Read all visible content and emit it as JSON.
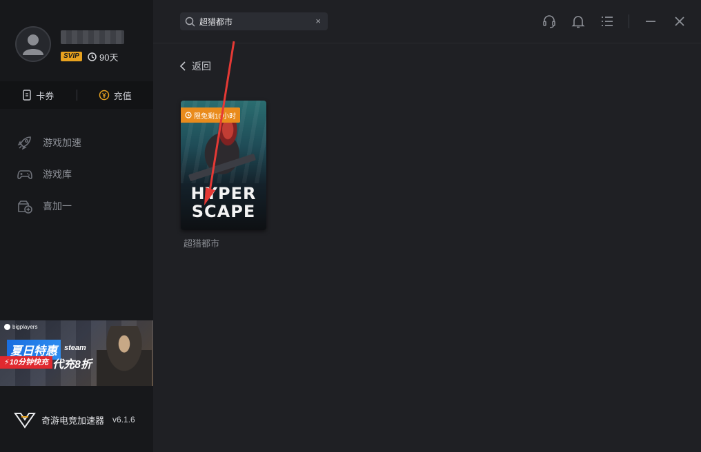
{
  "user": {
    "vip_badge": "SVIP",
    "days_left": "90天"
  },
  "wallet": {
    "coupons_label": "卡券",
    "recharge_label": "充值"
  },
  "nav": {
    "items": [
      {
        "label": "游戏加速",
        "icon": "rocket-icon"
      },
      {
        "label": "游戏库",
        "icon": "gamepad-icon"
      },
      {
        "label": "喜加一",
        "icon": "gift-plus-icon"
      }
    ]
  },
  "banner": {
    "brand": "bigplayers",
    "headline": "夏日特惠",
    "platform": "steam",
    "fast": "10分钟快充",
    "discount": "代充8折"
  },
  "app": {
    "name": "奇游电竞加速器",
    "version": "v6.1.6"
  },
  "search": {
    "value": "超猎都市",
    "clear": "×"
  },
  "main": {
    "back_label": "返回"
  },
  "game": {
    "name": "超猎都市",
    "badge": "限免剩10小时",
    "art_line1": "HYPER",
    "art_line2": "SCAPE"
  },
  "colors": {
    "accent": "#e98b1c",
    "annotation": "#e53935"
  }
}
